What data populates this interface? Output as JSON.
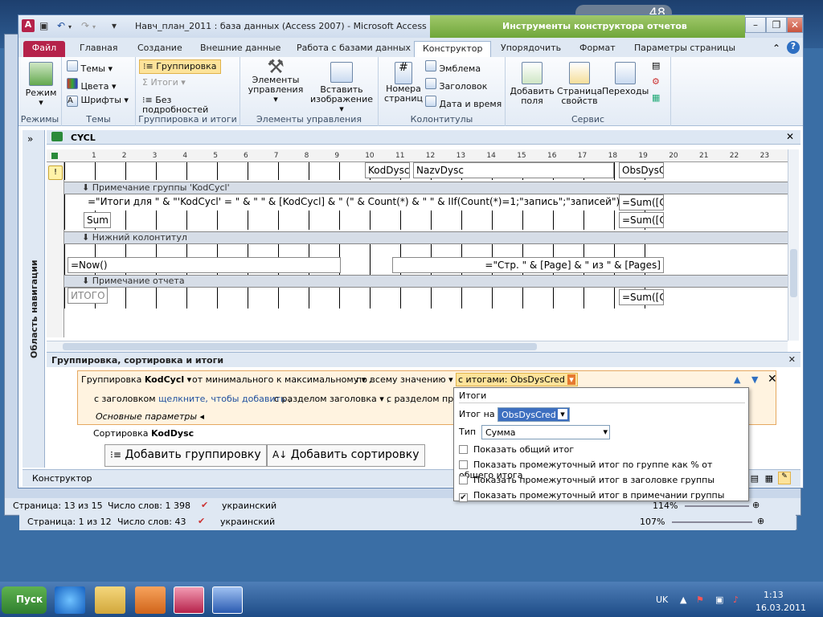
{
  "access": {
    "title": "Навч_план_2011 : база данных (Access 2007)  -  Microsoft Access",
    "context_title": "Инструменты конструктора отчетов",
    "tabs": [
      "Файл",
      "Главная",
      "Создание",
      "Внешние данные",
      "Работа с базами данных",
      "Конструктор",
      "Упорядочить",
      "Формат",
      "Параметры страницы"
    ],
    "ribbon": {
      "views": {
        "label": "Режимы",
        "btn": "Режим"
      },
      "themes": {
        "label": "Темы",
        "items": [
          "Темы",
          "Цвета",
          "Шрифты"
        ]
      },
      "grouping": {
        "label": "Группировка и итоги",
        "items": [
          "Группировка",
          "Итоги",
          "Без подробностей"
        ]
      },
      "controls": {
        "label": "Элементы управления",
        "btn1": "Элементы управления",
        "btn2": "Вставить изображение"
      },
      "headerfooter": {
        "label": "Колонтитулы",
        "btn": "Номера страниц",
        "items": [
          "Эмблема",
          "Заголовок",
          "Дата и время"
        ]
      },
      "tools": {
        "label": "Сервис",
        "btn1": "Добавить поля",
        "btn2": "Страница свойств",
        "btn3": "Переходы"
      }
    },
    "doc_tab": "CYCL",
    "nav_pane": "Область навигации",
    "sections": {
      "group_footer": "Примечание группы 'KodCycl'",
      "page_footer": "Нижний колонтитул",
      "report_footer": "Примечание отчета"
    },
    "controls": {
      "kod": "KodDysc",
      "nazv": "NazvDysc",
      "obs": "ObsDysC",
      "expr": "=\"Итоги для \" & \"'KodCycl' = \" & \" \" & [KodCycl] & \" (\" & Count(*) & \" \" & IIf(Count(*)=1;\"запись\";\"записей\") &",
      "sum1": "=Sum([C",
      "sum_label": "Sum",
      "sum2": "=Sum([C",
      "now": "=Now()",
      "pages": "=\"Стр. \" & [Page] & \" из \" & [Pages]",
      "itogo": "ИТОГО",
      "sum3": "=Sum([C"
    },
    "ruler_ticks": [
      "1",
      "2",
      "3",
      "4",
      "5",
      "6",
      "7",
      "8",
      "9",
      "10",
      "11",
      "12",
      "13",
      "14",
      "15",
      "16",
      "17",
      "18",
      "19",
      "20",
      "21",
      "22",
      "23"
    ],
    "grouping_pane": {
      "title": "Группировка, сортировка и итоги",
      "group_prefix": "Группировка",
      "group_field": "KodCycl",
      "order": "от минимального к максимальному",
      "by": "по всему значению",
      "totals": "с итогами: ObsDysCred",
      "with_header": "с заголовком",
      "header_link": "щелкните, чтобы добавить",
      "with_header_section": "с разделом заголовка",
      "with_footer": "с разделом приме",
      "basic": "Основные параметры",
      "sort_prefix": "Сортировка",
      "sort_field": "KodDysc",
      "add_group": "Добавить группировку",
      "add_sort": "Добавить сортировку"
    },
    "popup": {
      "title": "Итоги",
      "total_on_label": "Итог на",
      "total_on_value": "ObsDysCred",
      "type_label": "Тип",
      "type_value": "Сумма",
      "options": [
        {
          "text": "Показать общий итог",
          "checked": false
        },
        {
          "text": "Показать промежуточный итог по группе как % от общего итога",
          "checked": false
        },
        {
          "text": "Показать промежуточный итог в заголовке группы",
          "checked": false
        },
        {
          "text": "Показать промежуточный итог в примечании группы",
          "checked": true
        }
      ]
    },
    "status": "Конструктор"
  },
  "word1_status": {
    "page": "Страница: 13 из 15",
    "words": "Число слов: 1 398",
    "lang": "украинский",
    "zoom": "114%"
  },
  "word2_status": {
    "page": "Страница: 1 из 12",
    "words": "Число слов: 43",
    "lang": "украинский",
    "zoom": "107%"
  },
  "taskbar": {
    "start": "Пуск",
    "lang": "UK",
    "time": "1:13",
    "date": "16.03.2011"
  },
  "desktop_temp": "48"
}
